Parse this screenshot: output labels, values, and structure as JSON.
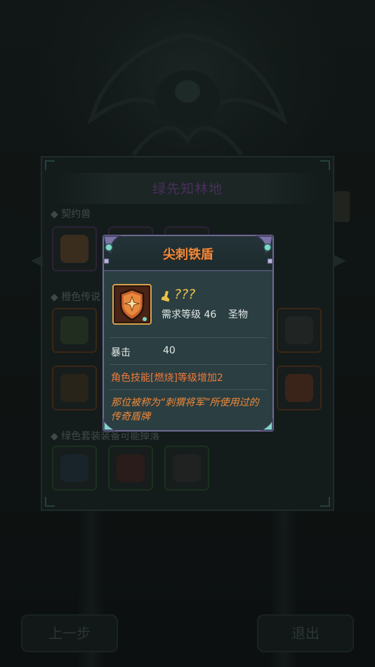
{
  "background": {
    "panel_title": "绿先知林地",
    "sections": [
      {
        "label": "◆ 契约兽"
      },
      {
        "label": "◆ 橙色传说"
      },
      {
        "label": "◆ 绿色套装装备可能掉落"
      }
    ],
    "buttons": {
      "prev_label": "上一步",
      "exit_label": "退出"
    }
  },
  "popup": {
    "title": "尖刺铁盾",
    "item": {
      "name": "???",
      "required_level_label": "需求等级 46",
      "type_label": "圣物"
    },
    "stat": {
      "label": "暴击",
      "value": "40"
    },
    "skill_text": "角色技能[燃烧]等级增加2",
    "description": "那位被称为“刺猬将军”所使用过的传奇盾牌"
  },
  "colors": {
    "title_orange": "#f08a3c",
    "name_gold": "#e8c24a",
    "skill_orange": "#f07a3a",
    "popup_bg": "#2b3e41",
    "popup_border": "#6e6a8e"
  },
  "icons": [
    "shield-item-icon",
    "boot-icon",
    "prev-arrow-icon",
    "next-arrow-icon"
  ]
}
